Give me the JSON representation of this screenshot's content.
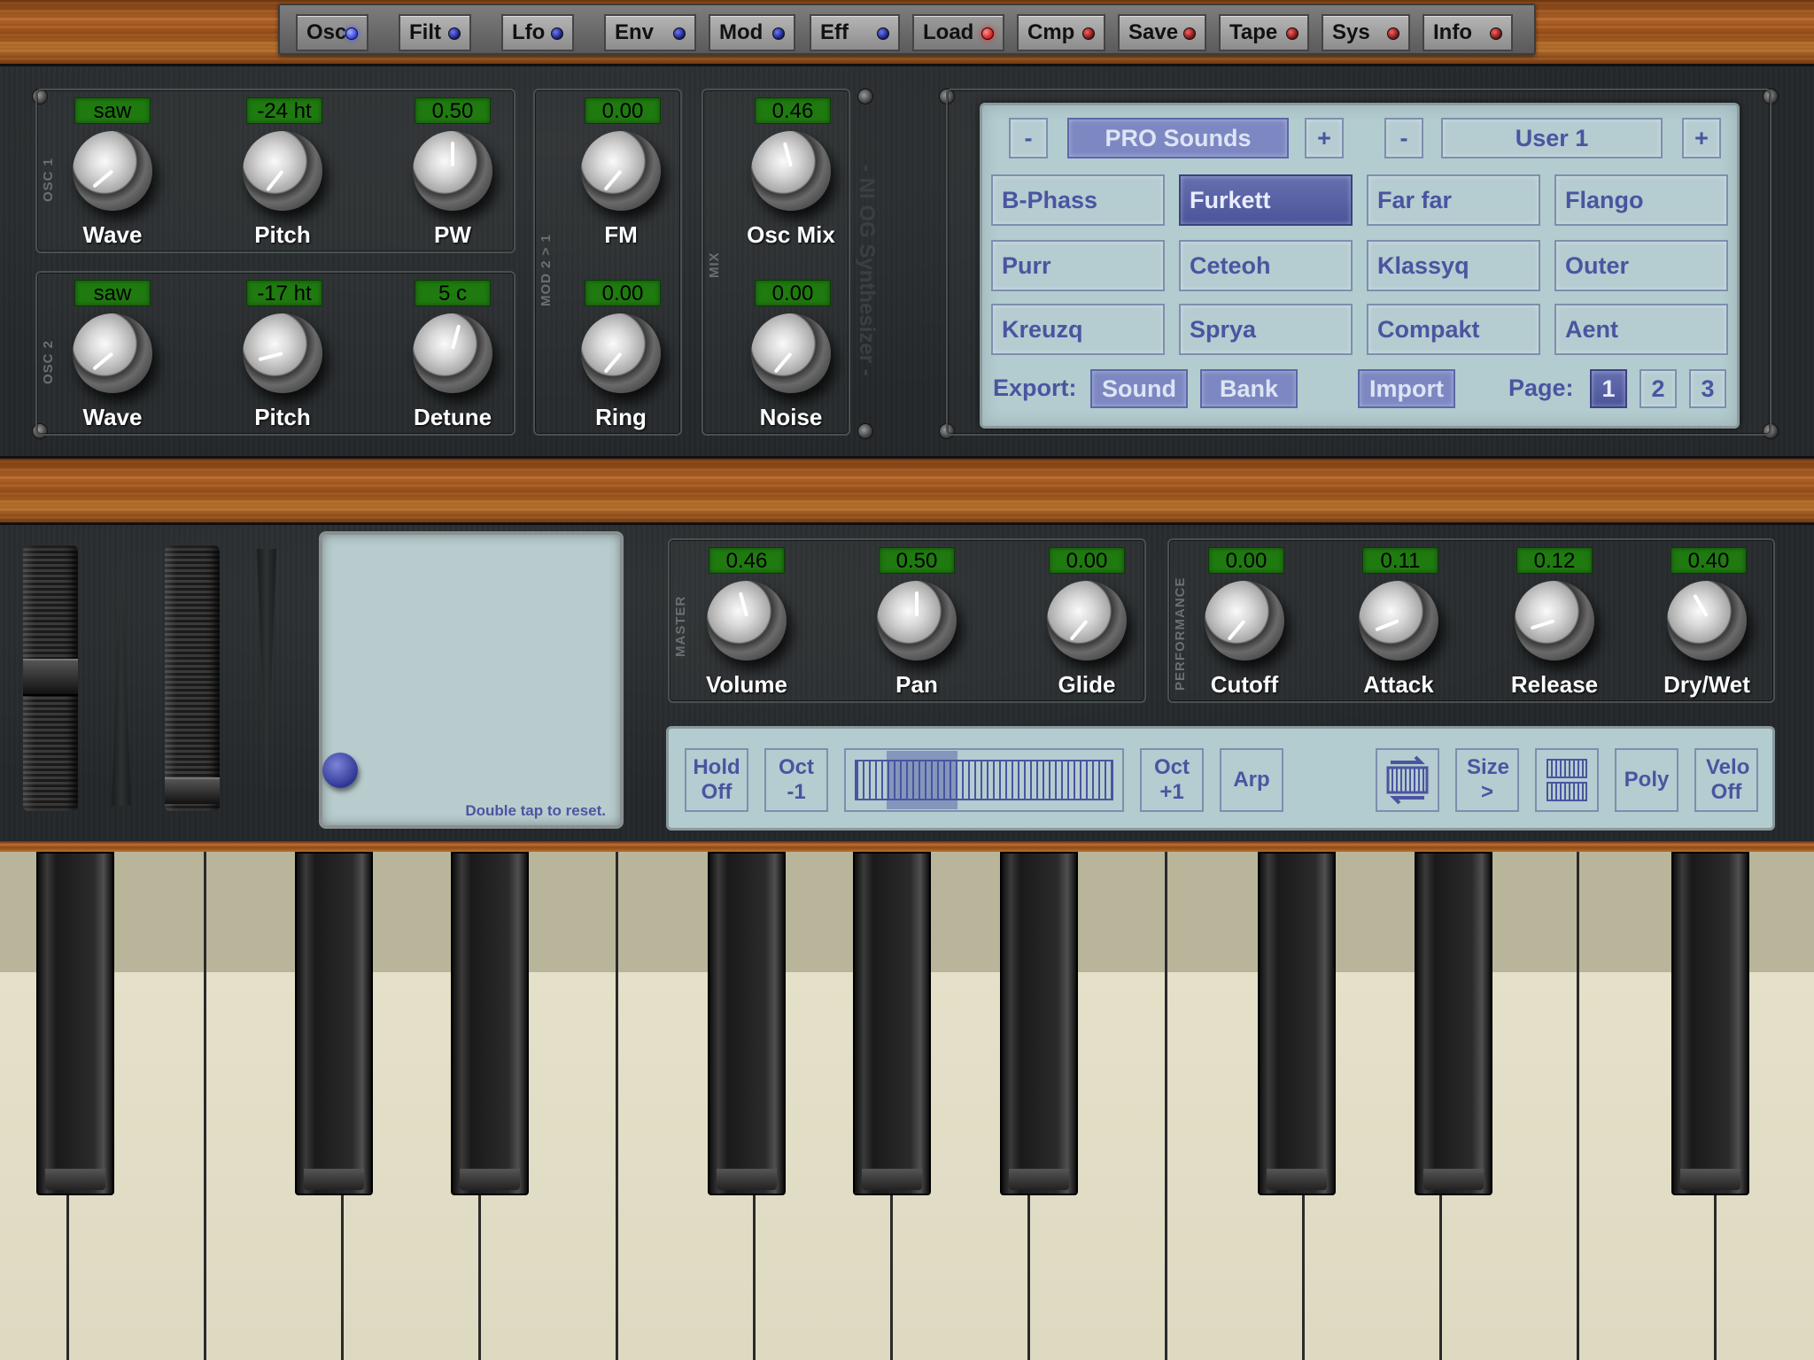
{
  "tabs": [
    {
      "label": "Osc",
      "led": "blue",
      "on": true
    },
    {
      "label": "Filt",
      "led": "blue",
      "on": false
    },
    {
      "label": "Lfo",
      "led": "blue",
      "on": false
    },
    {
      "label": "Env",
      "led": "blue",
      "on": false
    },
    {
      "label": "Mod",
      "led": "blue",
      "on": false
    },
    {
      "label": "Eff",
      "led": "blue",
      "on": false
    },
    {
      "label": "Load",
      "led": "red",
      "on": true
    },
    {
      "label": "Cmp",
      "led": "red",
      "on": false
    },
    {
      "label": "Save",
      "led": "red",
      "on": false
    },
    {
      "label": "Tape",
      "led": "red",
      "on": false
    },
    {
      "label": "Sys",
      "led": "red",
      "on": false
    },
    {
      "label": "Info",
      "led": "red",
      "on": false
    }
  ],
  "osc1": {
    "section": "OSC 1",
    "wave": {
      "label": "Wave",
      "value": "saw"
    },
    "pitch": {
      "label": "Pitch",
      "value": "-24 ht"
    },
    "pw": {
      "label": "PW",
      "value": "0.50"
    }
  },
  "osc2": {
    "section": "OSC 2",
    "wave": {
      "label": "Wave",
      "value": "saw"
    },
    "pitch": {
      "label": "Pitch",
      "value": "-17 ht"
    },
    "detune": {
      "label": "Detune",
      "value": "5 c"
    }
  },
  "mod": {
    "section": "MOD 2 > 1",
    "fm": {
      "label": "FM",
      "value": "0.00"
    },
    "ring": {
      "label": "Ring",
      "value": "0.00"
    }
  },
  "mix": {
    "section": "MIX",
    "oscmix": {
      "label": "Osc Mix",
      "value": "0.46"
    },
    "noise": {
      "label": "Noise",
      "value": "0.00"
    }
  },
  "brand": "- NI OG Synthesizer -",
  "presets": {
    "bank_minus": "-",
    "bank_name": "PRO Sounds",
    "bank_plus": "+",
    "user_minus": "-",
    "user_name": "User 1",
    "user_plus": "+",
    "grid": [
      "B-Phass",
      "Furkett",
      "Far far",
      "Flango",
      "Purr",
      "Ceteoh",
      "Klassyq",
      "Outer",
      "Kreuzq",
      "Sprya",
      "Compakt",
      "Aent"
    ],
    "selected": "Furkett",
    "export_label": "Export:",
    "export_sound": "Sound",
    "export_bank": "Bank",
    "import": "Import",
    "page_label": "Page:",
    "pages": [
      "1",
      "2",
      "3"
    ],
    "page_selected": "1"
  },
  "master": {
    "section": "MASTER",
    "volume": {
      "label": "Volume",
      "value": "0.46"
    },
    "pan": {
      "label": "Pan",
      "value": "0.50"
    },
    "glide": {
      "label": "Glide",
      "value": "0.00"
    }
  },
  "performance": {
    "section": "PERFORMANCE",
    "cutoff": {
      "label": "Cutoff",
      "value": "0.00"
    },
    "attack": {
      "label": "Attack",
      "value": "0.11"
    },
    "release": {
      "label": "Release",
      "value": "0.12"
    },
    "drywet": {
      "label": "Dry/Wet",
      "value": "0.40"
    }
  },
  "xypad": {
    "hint": "Double tap to reset."
  },
  "controls": {
    "hold": "Hold Off",
    "oct_minus": "Oct -1",
    "oct_plus": "Oct +1",
    "arp": "Arp",
    "size": "Size >",
    "poly": "Poly",
    "velo": "Velo Off"
  },
  "colors": {
    "accent": "#4a55a0",
    "lcd": "#1f7a10",
    "panel": "#b3ccd0",
    "selected": "#5660a6"
  }
}
